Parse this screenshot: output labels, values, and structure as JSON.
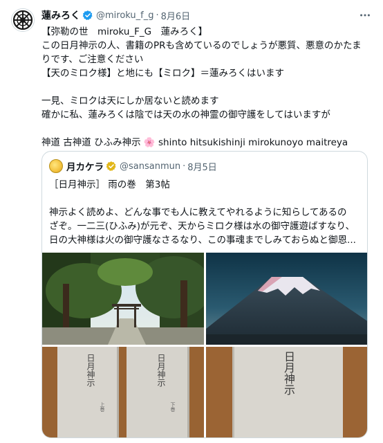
{
  "tweet": {
    "display_name": "蓮みろく",
    "handle": "@miroku_f_g",
    "separator": "·",
    "date": "8月6日",
    "lines": [
      "【弥勒の世　miroku_F_G　蓮みろく】",
      "この日月神示の人、書籍のPRも含めているのでしょうが悪質、悪意のかたま",
      "りです、ご注意ください",
      "【天のミロク様】と地にも【ミロク】＝蓮みろくはいます",
      "",
      "一見、ミロクは天にしか居ないと読めます",
      "確かに私、蓮みろくは陰では天の水の神霊の御守護をしてはいますが",
      "",
      "神道 古神道 ひふみ神示 🌸 shinto hitsukishinji mirokunoyo maitreya"
    ]
  },
  "quoted": {
    "display_name": "月カケラ",
    "handle": "@sansanmun",
    "separator": "·",
    "date": "8月5日",
    "lines": [
      "［日月神示］ 雨の巻　第3帖",
      "",
      "神示よく読めよ、どんな事でも人に教えてやれるように知らしてあるの",
      "ざぞ。一二三(ひふみ)が元ぞ、天からミロク様は水の御守護遊ばすなり、",
      "日の大神様は火の御守護なさるなり、この事魂までしみておらぬと御恩..."
    ],
    "images": [
      "forest-shrine-torii",
      "mount-fuji",
      "book-volumes",
      "book-cover"
    ],
    "book_spine": {
      "title": "日月神示",
      "tag_left": "上巻",
      "tag_right": "下巻"
    }
  },
  "colors": {
    "verified_blue": "#1d9bf0",
    "verified_gold": "#e2b719",
    "secondary_text": "#536471",
    "border": "#cfd9de"
  }
}
